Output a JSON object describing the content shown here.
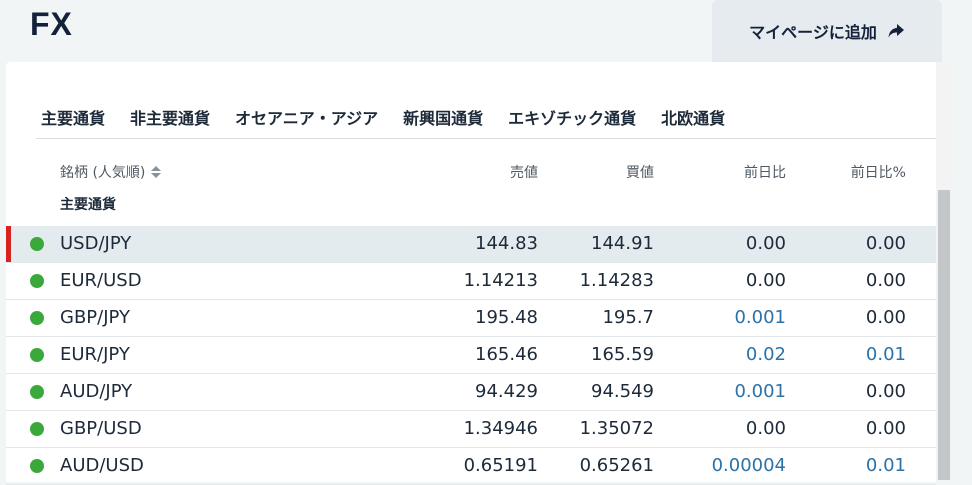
{
  "page": {
    "title": "FX"
  },
  "actions": {
    "add_mypage_label": "マイページに追加"
  },
  "tabs": [
    {
      "label": "主要通貨"
    },
    {
      "label": "非主要通貨"
    },
    {
      "label": "オセアニア・アジア"
    },
    {
      "label": "新興国通貨"
    },
    {
      "label": "エキゾチック通貨"
    },
    {
      "label": "北欧通貨"
    }
  ],
  "table": {
    "headers": {
      "name": "銘柄 (人気順)",
      "bid": "売値",
      "ask": "買値",
      "change": "前日比",
      "change_pct": "前日比%"
    },
    "group_label": "主要通貨",
    "rows": [
      {
        "name": "USD/JPY",
        "bid": "144.83",
        "ask": "144.91",
        "change": "0.00",
        "change_pct": "0.00"
      },
      {
        "name": "EUR/USD",
        "bid": "1.14213",
        "ask": "1.14283",
        "change": "0.00",
        "change_pct": "0.00"
      },
      {
        "name": "GBP/JPY",
        "bid": "195.48",
        "ask": "195.7",
        "change": "0.001",
        "change_pct": "0.00"
      },
      {
        "name": "EUR/JPY",
        "bid": "165.46",
        "ask": "165.59",
        "change": "0.02",
        "change_pct": "0.01"
      },
      {
        "name": "AUD/JPY",
        "bid": "94.429",
        "ask": "94.549",
        "change": "0.001",
        "change_pct": "0.00"
      },
      {
        "name": "GBP/USD",
        "bid": "1.34946",
        "ask": "1.35072",
        "change": "0.00",
        "change_pct": "0.00"
      },
      {
        "name": "AUD/USD",
        "bid": "0.65191",
        "ask": "0.65261",
        "change": "0.00004",
        "change_pct": "0.01"
      }
    ]
  },
  "colors": {
    "status_dot": "#3aa83a",
    "selected_marker": "#d6231f",
    "positive_change": "#2b72a8"
  }
}
